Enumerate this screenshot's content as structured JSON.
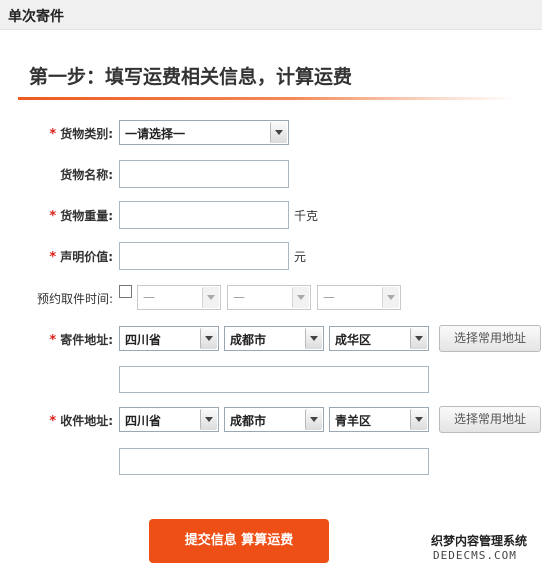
{
  "header": {
    "title": "单次寄件"
  },
  "step": {
    "title": "第一步：填写运费相关信息，计算运费"
  },
  "form": {
    "required_mark": "*",
    "cargo_type": {
      "label": "货物类别:",
      "value": "一请选择一"
    },
    "cargo_name": {
      "label": "货物名称:",
      "value": ""
    },
    "cargo_weight": {
      "label": "货物重量:",
      "value": "",
      "unit": "千克"
    },
    "declared_value": {
      "label": "声明价值:",
      "value": "",
      "unit": "元"
    },
    "pickup_time": {
      "label": "预约取件时间:",
      "date": "—",
      "hour": "—",
      "minute": "—"
    },
    "sender": {
      "label": "寄件地址:",
      "province": "四川省",
      "city": "成都市",
      "district": "成华区",
      "detail": "",
      "common_btn": "选择常用地址"
    },
    "receiver": {
      "label": "收件地址:",
      "province": "四川省",
      "city": "成都市",
      "district": "青羊区",
      "detail": "",
      "common_btn": "选择常用地址"
    },
    "submit_label": "提交信息 算算运费"
  },
  "watermark": {
    "line1": "织梦内容管理系统",
    "line2": "DEDECMS.COM"
  },
  "colors": {
    "accent": "#ee4f16",
    "required": "#d8231c"
  }
}
